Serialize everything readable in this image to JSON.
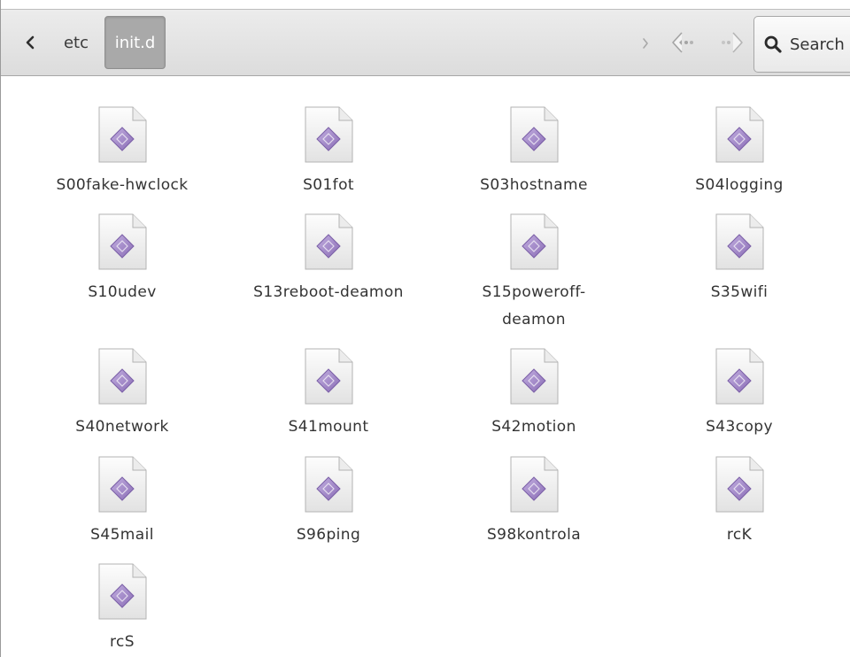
{
  "breadcrumb": {
    "items": [
      {
        "label": "etc",
        "active": false
      },
      {
        "label": "init.d",
        "active": true
      }
    ]
  },
  "search": {
    "label": "Search"
  },
  "icons": {
    "back": "chevron-left-icon",
    "forward_crumb": "chevron-right-icon",
    "nav_back": "arrow-back-icon",
    "nav_forward": "arrow-forward-icon",
    "search": "magnifier-icon",
    "file": "script-file-icon"
  },
  "colors": {
    "toolbar": "#e3e3e3",
    "active_crumb": "#a9a9a9",
    "file_diamond": "#9b7fc2"
  },
  "files": [
    {
      "name": "S00fake-hwclock"
    },
    {
      "name": "S01fot"
    },
    {
      "name": "S03hostname"
    },
    {
      "name": "S04logging"
    },
    {
      "name": "S10udev"
    },
    {
      "name": "S13reboot-deamon"
    },
    {
      "name": "S15poweroff-\ndeamon"
    },
    {
      "name": "S35wifi"
    },
    {
      "name": "S40network"
    },
    {
      "name": "S41mount"
    },
    {
      "name": "S42motion"
    },
    {
      "name": "S43copy"
    },
    {
      "name": "S45mail"
    },
    {
      "name": "S96ping"
    },
    {
      "name": "S98kontrola"
    },
    {
      "name": "rcK"
    },
    {
      "name": "rcS"
    }
  ]
}
